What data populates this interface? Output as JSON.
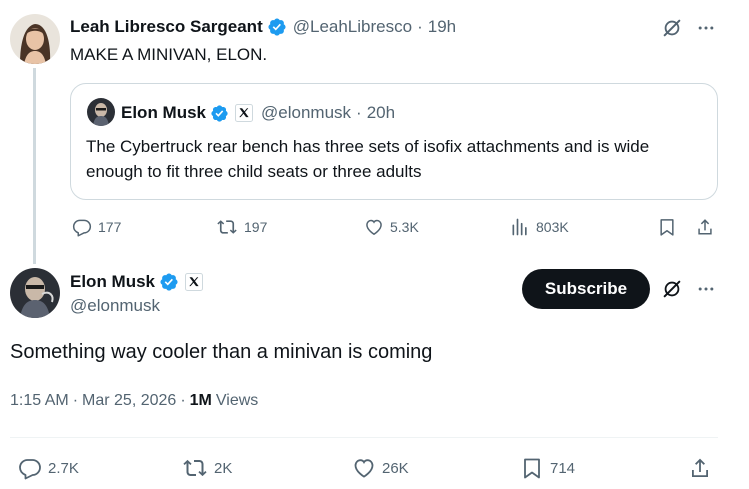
{
  "parent_post": {
    "name": "Leah Libresco Sargeant",
    "handle": "@LeahLibresco",
    "separator": "·",
    "time": "19h",
    "text": "MAKE A MINIVAN, ELON.",
    "quote": {
      "name": "Elon Musk",
      "handle": "@elonmusk",
      "separator": "·",
      "time": "20h",
      "text": "The Cybertruck rear bench has three sets of isofix attachments and is wide enough to fit three child seats or three adults"
    },
    "actions": {
      "replies": "177",
      "reposts": "197",
      "likes": "5.3K",
      "views": "803K"
    }
  },
  "main_post": {
    "name": "Elon Musk",
    "handle": "@elonmusk",
    "subscribe_label": "Subscribe",
    "text": "Something way cooler than a minivan is coming",
    "time": "1:15 AM",
    "date_separator": "·",
    "date": "Mar 25, 2026",
    "views_separator": "·",
    "views_count": "1M",
    "views_label": "Views",
    "actions": {
      "replies": "2.7K",
      "reposts": "2K",
      "likes": "26K",
      "bookmarks": "714"
    }
  },
  "colors": {
    "verified": "#1d9bf0",
    "text_primary": "#0f1419",
    "text_secondary": "#536471",
    "border": "#cfd9de"
  },
  "icons": [
    "verified-badge-icon",
    "grok-icon",
    "more-icon",
    "x-logo-icon",
    "reply-icon",
    "repost-icon",
    "like-icon",
    "views-icon",
    "bookmark-icon",
    "share-icon"
  ]
}
